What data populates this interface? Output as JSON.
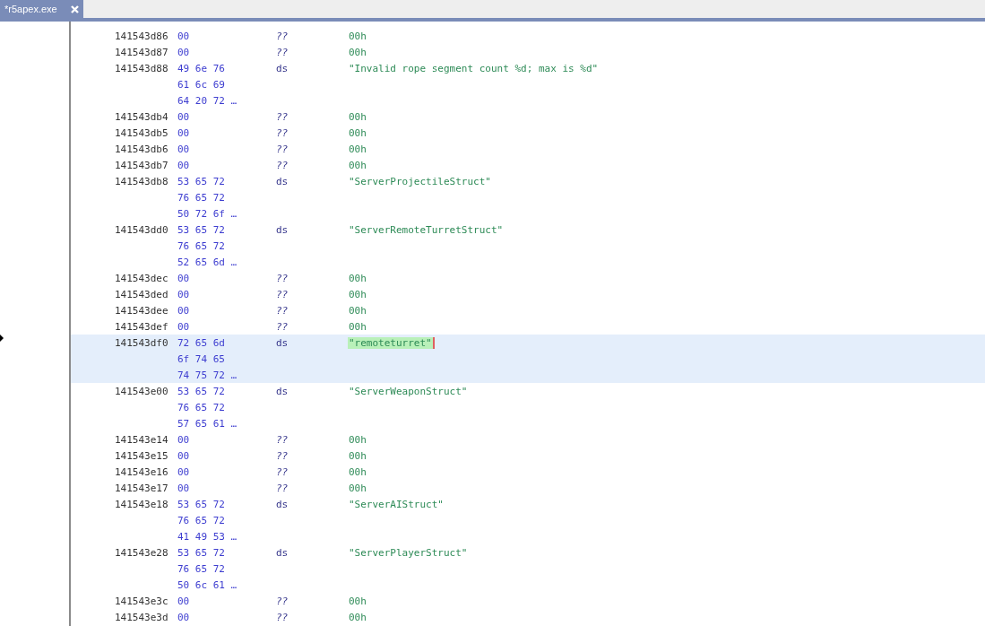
{
  "tab": {
    "label": "*r5apex.exe",
    "selected": true
  },
  "lines": [
    {
      "address": "141543d86",
      "bytes": "00",
      "mnemonic": "??",
      "operand": "00h",
      "selected": false,
      "cursor": false
    },
    {
      "address": "141543d87",
      "bytes": "00",
      "mnemonic": "??",
      "operand": "00h",
      "selected": false,
      "cursor": false
    },
    {
      "address": "141543d88",
      "bytes": "49 6e 76",
      "mnemonic": "ds",
      "operand": "\"Invalid rope segment count %d; max is %d\"",
      "selected": false,
      "cursor": false
    },
    {
      "bytes": "61 6c 69",
      "selected": false
    },
    {
      "bytes": "64 20 72 …",
      "selected": false
    },
    {
      "address": "141543db4",
      "bytes": "00",
      "mnemonic": "??",
      "operand": "00h",
      "selected": false,
      "cursor": false
    },
    {
      "address": "141543db5",
      "bytes": "00",
      "mnemonic": "??",
      "operand": "00h",
      "selected": false,
      "cursor": false
    },
    {
      "address": "141543db6",
      "bytes": "00",
      "mnemonic": "??",
      "operand": "00h",
      "selected": false,
      "cursor": false
    },
    {
      "address": "141543db7",
      "bytes": "00",
      "mnemonic": "??",
      "operand": "00h",
      "selected": false,
      "cursor": false
    },
    {
      "address": "141543db8",
      "bytes": "53 65 72",
      "mnemonic": "ds",
      "operand": "\"ServerProjectileStruct\"",
      "selected": false,
      "cursor": false
    },
    {
      "bytes": "76 65 72",
      "selected": false
    },
    {
      "bytes": "50 72 6f …",
      "selected": false
    },
    {
      "address": "141543dd0",
      "bytes": "53 65 72",
      "mnemonic": "ds",
      "operand": "\"ServerRemoteTurretStruct\"",
      "selected": false,
      "cursor": false
    },
    {
      "bytes": "76 65 72",
      "selected": false
    },
    {
      "bytes": "52 65 6d …",
      "selected": false
    },
    {
      "address": "141543dec",
      "bytes": "00",
      "mnemonic": "??",
      "operand": "00h",
      "selected": false,
      "cursor": false
    },
    {
      "address": "141543ded",
      "bytes": "00",
      "mnemonic": "??",
      "operand": "00h",
      "selected": false,
      "cursor": false
    },
    {
      "address": "141543dee",
      "bytes": "00",
      "mnemonic": "??",
      "operand": "00h",
      "selected": false,
      "cursor": false
    },
    {
      "address": "141543def",
      "bytes": "00",
      "mnemonic": "??",
      "operand": "00h",
      "selected": false,
      "cursor": false
    },
    {
      "address": "141543df0",
      "bytes": "72 65 6d",
      "mnemonic": "ds",
      "operand": "\"remoteturret\"",
      "selected": true,
      "cursor": true
    },
    {
      "bytes": "6f 74 65",
      "selected": true
    },
    {
      "bytes": "74 75 72 …",
      "selected": true
    },
    {
      "address": "141543e00",
      "bytes": "53 65 72",
      "mnemonic": "ds",
      "operand": "\"ServerWeaponStruct\"",
      "selected": false,
      "cursor": false
    },
    {
      "bytes": "76 65 72",
      "selected": false
    },
    {
      "bytes": "57 65 61 …",
      "selected": false
    },
    {
      "address": "141543e14",
      "bytes": "00",
      "mnemonic": "??",
      "operand": "00h",
      "selected": false,
      "cursor": false
    },
    {
      "address": "141543e15",
      "bytes": "00",
      "mnemonic": "??",
      "operand": "00h",
      "selected": false,
      "cursor": false
    },
    {
      "address": "141543e16",
      "bytes": "00",
      "mnemonic": "??",
      "operand": "00h",
      "selected": false,
      "cursor": false
    },
    {
      "address": "141543e17",
      "bytes": "00",
      "mnemonic": "??",
      "operand": "00h",
      "selected": false,
      "cursor": false
    },
    {
      "address": "141543e18",
      "bytes": "53 65 72",
      "mnemonic": "ds",
      "operand": "\"ServerAIStruct\"",
      "selected": false,
      "cursor": false
    },
    {
      "bytes": "76 65 72",
      "selected": false
    },
    {
      "bytes": "41 49 53 …",
      "selected": false
    },
    {
      "address": "141543e28",
      "bytes": "53 65 72",
      "mnemonic": "ds",
      "operand": "\"ServerPlayerStruct\"",
      "selected": false,
      "cursor": false
    },
    {
      "bytes": "76 65 72",
      "selected": false
    },
    {
      "bytes": "50 6c 61 …",
      "selected": false
    },
    {
      "address": "141543e3c",
      "bytes": "00",
      "mnemonic": "??",
      "operand": "00h",
      "selected": false,
      "cursor": false
    },
    {
      "address": "141543e3d",
      "bytes": "00",
      "mnemonic": "??",
      "operand": "00h",
      "selected": false,
      "cursor": false
    }
  ]
}
